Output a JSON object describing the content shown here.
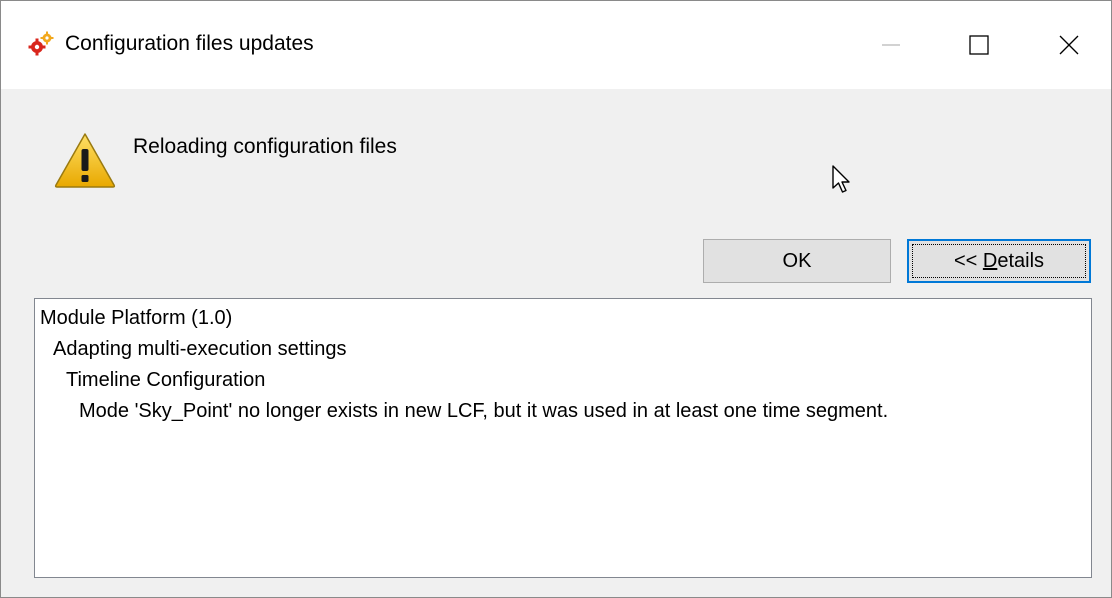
{
  "window": {
    "title": "Configuration files updates",
    "controls": {
      "minimize": "minimize",
      "maximize": "maximize",
      "close": "close"
    }
  },
  "dialog": {
    "message": "Reloading configuration files",
    "icon": "warning-icon"
  },
  "buttons": {
    "ok_label": "OK",
    "details_prefix": "<< ",
    "details_mnemonic": "D",
    "details_rest": "etails"
  },
  "details": {
    "lines": [
      "Module Platform (1.0)",
      "Adapting multi-execution settings",
      "Timeline Configuration",
      "Mode 'Sky_Point' no longer exists in new LCF, but it was used in at least one time segment."
    ]
  },
  "colors": {
    "accent": "#0078d7",
    "dialog_bg": "#f0f0f0",
    "warning_yellow": "#f5c400"
  }
}
